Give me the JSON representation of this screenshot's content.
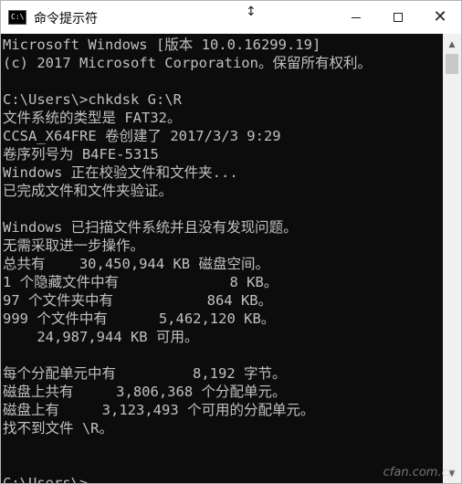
{
  "window": {
    "title": "命令提示符",
    "app_icon_text": "C:\\"
  },
  "console": {
    "lines": [
      "Microsoft Windows [版本 10.0.16299.19]",
      "(c) 2017 Microsoft Corporation。保留所有权利。",
      "",
      "C:\\Users\\>chkdsk G:\\R",
      "文件系统的类型是 FAT32。",
      "CCSA_X64FRE 卷创建了 2017/3/3 9:29",
      "卷序列号为 B4FE-5315",
      "Windows 正在校验文件和文件夹...",
      "已完成文件和文件夹验证。",
      "",
      "Windows 已扫描文件系统并且没有发现问题。",
      "无需采取进一步操作。",
      "总共有    30,450,944 KB 磁盘空间。",
      "1 个隐藏文件中有             8 KB。",
      "97 个文件夹中有           864 KB。",
      "999 个文件中有      5,462,120 KB。",
      "    24,987,944 KB 可用。",
      "",
      "每个分配单元中有         8,192 字节。",
      "磁盘上共有     3,806,368 个分配单元。",
      "磁盘上有     3,123,493 个可用的分配单元。",
      "找不到文件 \\R。",
      "",
      ""
    ],
    "prompt": "C:\\Users\\>"
  },
  "watermark": "cfan.com.cn"
}
